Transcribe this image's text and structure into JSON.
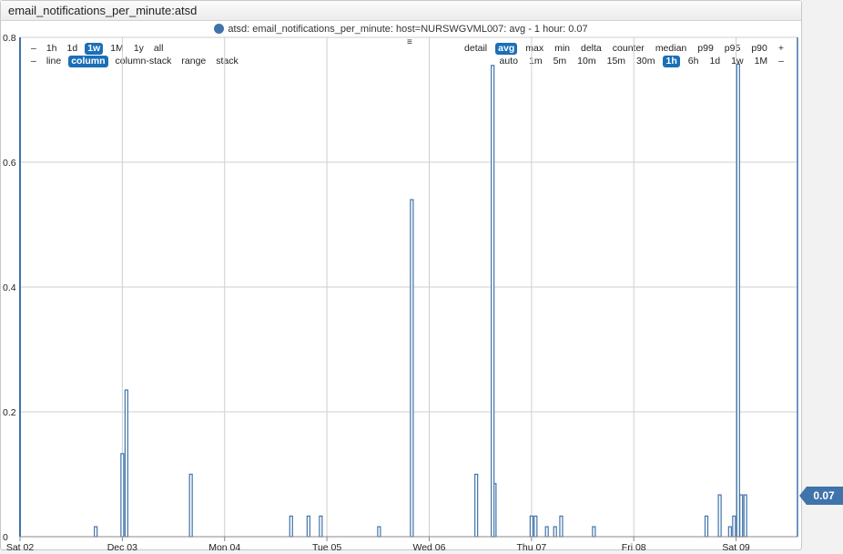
{
  "widget": {
    "title": "email_notifications_per_minute:atsd",
    "legend_text": "atsd: email_notifications_per_minute: host=NURSWGVML007: avg - 1 hour: 0.07",
    "menu_icon": "≡",
    "series_color": "#3f73aa",
    "badge_value": "0.07",
    "badge_color": "#3f73aa"
  },
  "toolbar": {
    "period_items": [
      "–",
      "1h",
      "1d",
      "1w",
      "1M",
      "1y",
      "all"
    ],
    "period_active": "1w",
    "style_items": [
      "–",
      "line",
      "column",
      "column-stack",
      "range",
      "stack"
    ],
    "style_active": "column",
    "stat_items": [
      "detail",
      "avg",
      "max",
      "min",
      "delta",
      "counter",
      "median",
      "p99",
      "p95",
      "p90",
      "+"
    ],
    "stat_active": "avg",
    "interval_items": [
      "auto",
      "1m",
      "5m",
      "10m",
      "15m",
      "30m",
      "1h",
      "6h",
      "1d",
      "1w",
      "1M",
      "–"
    ],
    "interval_active": "1h",
    "active_color": "#1b6fb7"
  },
  "chart_data": {
    "type": "bar",
    "title": "",
    "xlabel": "",
    "ylabel": "",
    "ylim": [
      0,
      0.8
    ],
    "yticks": [
      "0",
      "0.2",
      "0.4",
      "0.6",
      "0.8"
    ],
    "xlim_days": [
      0,
      7.6
    ],
    "xticks": [
      {
        "label": "Sat 02",
        "day": 0
      },
      {
        "label": "Dec 03",
        "day": 1
      },
      {
        "label": "Mon 04",
        "day": 2
      },
      {
        "label": "Tue 05",
        "day": 3
      },
      {
        "label": "Wed 06",
        "day": 4
      },
      {
        "label": "Thu 07",
        "day": 5
      },
      {
        "label": "Fri 08",
        "day": 6
      },
      {
        "label": "Sat 09",
        "day": 7
      }
    ],
    "grid": true,
    "series": [
      {
        "color": "#3f73aa",
        "x_day": [
          0.74,
          1.0,
          1.04,
          1.67,
          3.83,
          2.65,
          2.82,
          2.94,
          3.51,
          4.46,
          4.64,
          4.62,
          5.0,
          5.04,
          5.15,
          5.23,
          5.29,
          5.61,
          6.71,
          6.84,
          6.94,
          6.98,
          7.02,
          7.05,
          7.09
        ],
        "values": [
          0.016,
          0.133,
          0.235,
          0.1,
          0.54,
          0.033,
          0.033,
          0.033,
          0.016,
          0.1,
          0.085,
          0.755,
          0.033,
          0.033,
          0.016,
          0.016,
          0.033,
          0.016,
          0.033,
          0.067,
          0.016,
          0.033,
          0.757,
          0.067,
          0.067
        ]
      }
    ]
  }
}
